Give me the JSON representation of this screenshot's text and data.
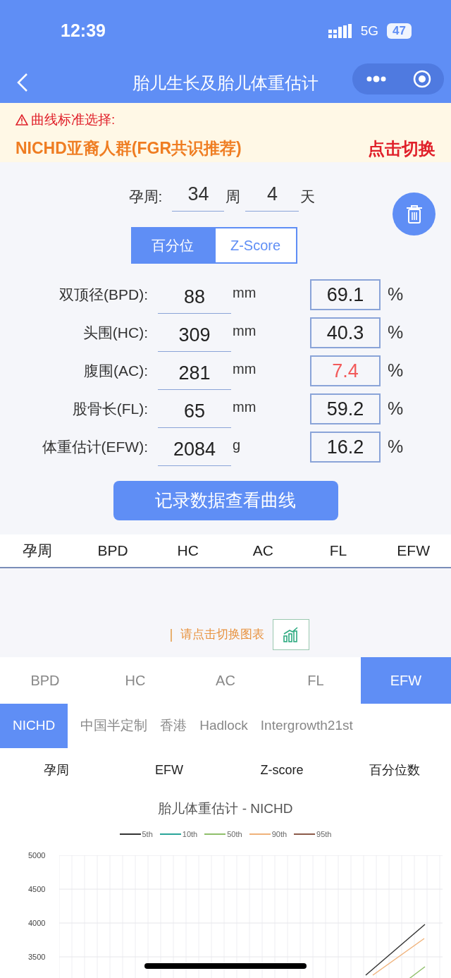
{
  "status_bar": {
    "time": "12:39",
    "network": "5G",
    "battery": "47"
  },
  "nav": {
    "title": "胎儿生长及胎儿体重估计"
  },
  "banner": {
    "label": "曲线标准选择:",
    "standard": "NICHD亚裔人群(FGR共识推荐)",
    "action": "点击切换"
  },
  "gestation": {
    "label": "孕周:",
    "weeks": "34",
    "weeks_unit": "周",
    "days": "4",
    "days_unit": "天"
  },
  "mode_tabs": [
    {
      "label": "百分位",
      "selected": true
    },
    {
      "label": "Z-Score",
      "selected": false
    }
  ],
  "measurements": [
    {
      "label": "双顶径(BPD):",
      "value": "88",
      "unit": "mm",
      "percentile": "69.1",
      "abnormal": false
    },
    {
      "label": "头围(HC):",
      "value": "309",
      "unit": "mm",
      "percentile": "40.3",
      "abnormal": false
    },
    {
      "label": "腹围(AC):",
      "value": "281",
      "unit": "mm",
      "percentile": "7.4",
      "abnormal": true
    },
    {
      "label": "股骨长(FL):",
      "value": "65",
      "unit": "mm",
      "percentile": "59.2",
      "abnormal": false
    },
    {
      "label": "体重估计(EFW):",
      "value": "2084",
      "unit": "g",
      "percentile": "16.2",
      "abnormal": false
    }
  ],
  "percent_sign": "%",
  "record_button": "记录数据查看曲线",
  "history_table": {
    "columns": [
      "孕周",
      "BPD",
      "HC",
      "AC",
      "FL",
      "EFW"
    ]
  },
  "chart_hint": "请点击切换图表",
  "metric_tabs": [
    {
      "label": "BPD",
      "selected": false
    },
    {
      "label": "HC",
      "selected": false
    },
    {
      "label": "AC",
      "selected": false
    },
    {
      "label": "FL",
      "selected": false
    },
    {
      "label": "EFW",
      "selected": true
    }
  ],
  "standard_tabs": [
    {
      "label": "NICHD",
      "selected": true
    },
    {
      "label": "中国半定制",
      "selected": false
    },
    {
      "label": "香港",
      "selected": false
    },
    {
      "label": "Hadlock",
      "selected": false
    },
    {
      "label": "Intergrowth21st",
      "selected": false
    }
  ],
  "result_columns": [
    "孕周",
    "EFW",
    "Z-score",
    "百分位数"
  ],
  "chart": {
    "title": "胎儿体重估计 - NICHD",
    "legend": [
      {
        "name": "5th",
        "color": "#333333"
      },
      {
        "name": "10th",
        "color": "#2aa59a"
      },
      {
        "name": "50th",
        "color": "#8fbf6a"
      },
      {
        "name": "90th",
        "color": "#f0b27a"
      },
      {
        "name": "95th",
        "color": "#8b5a4a"
      }
    ],
    "y_tick_labels": [
      "5000",
      "4500",
      "4000",
      "3500"
    ]
  }
}
